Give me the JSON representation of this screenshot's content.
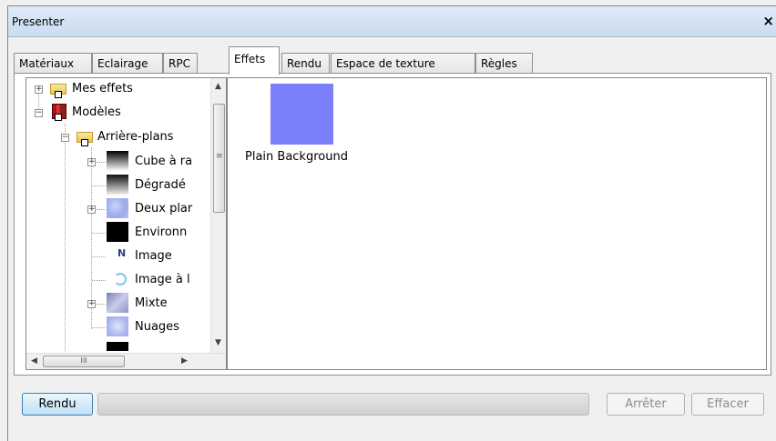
{
  "window": {
    "title": "Presenter",
    "close_glyph": "×"
  },
  "tabs": [
    {
      "label": "Matériaux"
    },
    {
      "label": "Eclairage"
    },
    {
      "label": "RPC"
    },
    {
      "label": "Effets"
    },
    {
      "label": "Rendu"
    },
    {
      "label": "Espace de texture"
    },
    {
      "label": "Règles"
    }
  ],
  "active_tab": "Effets",
  "tree": {
    "items": [
      {
        "label": "Mes effets",
        "icon": "folder-icon"
      },
      {
        "label": "Modèles",
        "icon": "books-icon"
      },
      {
        "label": "Arrière-plans",
        "icon": "folder-icon"
      },
      {
        "label": "Cube à ra",
        "icon": "gradient-thumbnail"
      },
      {
        "label": "Dégradé",
        "icon": "gradient-thumbnail"
      },
      {
        "label": "Deux plar",
        "icon": "texture-thumbnail"
      },
      {
        "label": "Environn",
        "icon": "black-thumbnail"
      },
      {
        "label": "Image",
        "icon": "image-icon"
      },
      {
        "label": "Image à l",
        "icon": "image-icon"
      },
      {
        "label": "Mixte",
        "icon": "texture-thumbnail"
      },
      {
        "label": "Nuages",
        "icon": "texture-thumbnail"
      }
    ],
    "hscroll_grip": "III"
  },
  "effects": [
    {
      "label": "Plain Background",
      "color": "#7b7ffa"
    }
  ],
  "buttons": {
    "render": "Rendu",
    "stop": "Arrêter",
    "clear": "Effacer"
  }
}
